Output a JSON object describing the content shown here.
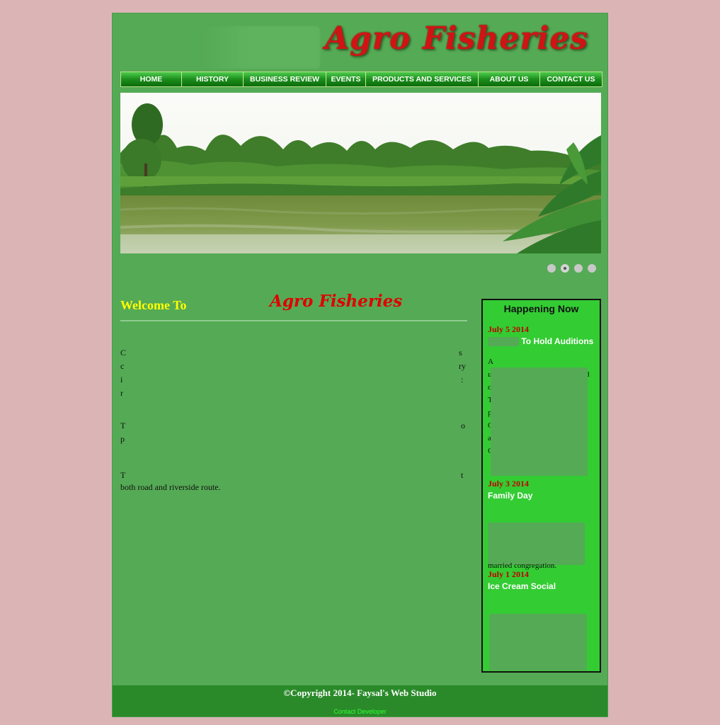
{
  "header": {
    "site_title": "Agro Fisheries"
  },
  "nav": {
    "items": [
      {
        "label": "HOME"
      },
      {
        "label": "HISTORY"
      },
      {
        "label": "BUSINESS REVIEW"
      },
      {
        "label": "EVENTS"
      },
      {
        "label": "PRODUCTS AND SERVICES"
      },
      {
        "label": "ABOUT US"
      },
      {
        "label": "CONTACT US"
      }
    ]
  },
  "slider": {
    "dot_count": 4,
    "active_dot": 2
  },
  "welcome": {
    "prefix": "Welcome To",
    "brand": "Agro Fisheries",
    "partial_line": "both road and riverside route."
  },
  "sidebar": {
    "heading": "Happening Now",
    "events": [
      {
        "date": "July 5 2014",
        "title": "To Hold Auditions"
      },
      {
        "date": "July 3 2014",
        "title": "Family Day",
        "snippet": "married congregation."
      },
      {
        "date": "July 1 2014",
        "title": "Ice Cream Social"
      }
    ]
  },
  "footer": {
    "copyright": "©Copyright 2014- Faysal's Web Studio",
    "contact_link": "Contact Developer"
  }
}
